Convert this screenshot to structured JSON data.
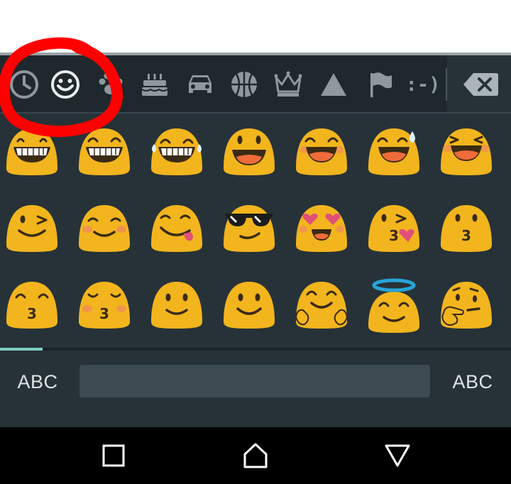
{
  "keyboard": {
    "categories": [
      {
        "name": "recent",
        "icon": "clock-icon"
      },
      {
        "name": "smileys",
        "icon": "smiley-icon",
        "selected": true
      },
      {
        "name": "nature",
        "icon": "paw-icon"
      },
      {
        "name": "food",
        "icon": "cake-icon"
      },
      {
        "name": "travel",
        "icon": "car-icon"
      },
      {
        "name": "activities",
        "icon": "basketball-icon"
      },
      {
        "name": "objects",
        "icon": "crown-icon"
      },
      {
        "name": "symbols",
        "icon": "triangle-icon"
      },
      {
        "name": "flags",
        "icon": "flag-icon"
      },
      {
        "name": "emoticons",
        "label": ":-)"
      }
    ],
    "backspace_icon": "backspace-icon",
    "emojis": [
      "grinning",
      "grinning-teeth",
      "tears-of-joy",
      "smiley-open-mouth",
      "smile-open-mouth-eyes",
      "sweat-smile",
      "laughing",
      "winking",
      "blushing",
      "yum",
      "sunglasses",
      "heart-eyes",
      "kissing-heart",
      "kissing",
      "kissing-smiling-eyes",
      "kissing-closed-eyes",
      "slightly-smiling",
      "smiling",
      "hugging",
      "innocent-halo",
      "thinking"
    ],
    "page_progress": 0.0833,
    "left_abc_label": "ABC",
    "right_abc_label": "ABC",
    "accent_color": "#80cbc4",
    "emoji_color": "#f2b51d"
  },
  "annotation": {
    "type": "red-hand-drawn-circle",
    "color": "#ff0000",
    "target": "smileys"
  },
  "nav": {
    "buttons": [
      "recents-square-icon",
      "home-icon",
      "back-icon"
    ]
  }
}
